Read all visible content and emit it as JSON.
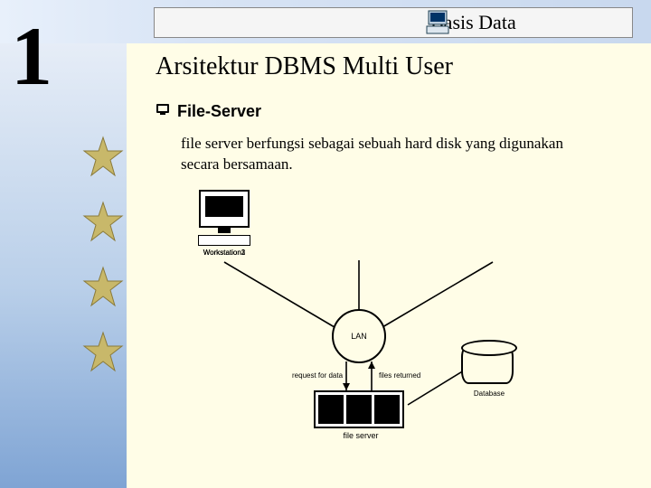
{
  "header": {
    "title": "Basis Data"
  },
  "chapter": {
    "number": "1"
  },
  "main": {
    "title": "Arsitektur DBMS Multi User",
    "sub_title": "File-Server",
    "body": "file server berfungsi sebagai sebuah hard disk yang digunakan secara bersamaan."
  },
  "diagram": {
    "ws1": "Workstation1",
    "ws2": "Workstation2",
    "ws3": "Workstation3",
    "lan": "LAN",
    "req": "request for data",
    "ret": "files returned",
    "fileserver": "file server",
    "database": "Database"
  }
}
